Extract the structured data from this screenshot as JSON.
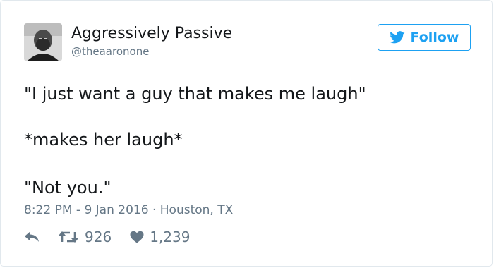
{
  "tweet": {
    "display_name": "Aggressively Passive",
    "handle": "@theaaronone",
    "follow_label": "Follow",
    "lines": [
      "\"I just want a guy that makes me laugh\"",
      "*makes her laugh*",
      "\"Not you.\""
    ],
    "time": "8:22 PM - 9 Jan 2016",
    "location": "Houston, TX",
    "retweets": "926",
    "likes": "1,239"
  },
  "colors": {
    "accent": "#1da1f2",
    "muted": "#657786",
    "text": "#14171a"
  },
  "icons": [
    "twitter-bird-icon",
    "reply-icon",
    "retweet-icon",
    "heart-icon"
  ]
}
